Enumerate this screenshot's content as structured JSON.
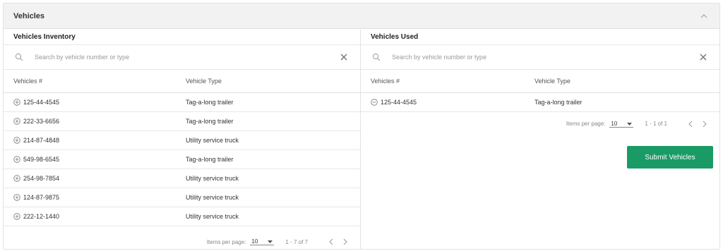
{
  "card": {
    "title": "Vehicles"
  },
  "inventory": {
    "title": "Vehicles Inventory",
    "search_placeholder": "Search by vehicle number or type",
    "columns": {
      "number": "Vehicles #",
      "type": "Vehicle Type"
    },
    "rows": [
      {
        "number": "125-44-4545",
        "type": "Tag-a-long trailer"
      },
      {
        "number": "222-33-6656",
        "type": "Tag-a-long trailer"
      },
      {
        "number": "214-87-4848",
        "type": "Utility service truck"
      },
      {
        "number": "549-98-6545",
        "type": "Tag-a-long trailer"
      },
      {
        "number": "254-98-7854",
        "type": "Utility service truck"
      },
      {
        "number": "124-87-9875",
        "type": "Utility service truck"
      },
      {
        "number": "222-12-1440",
        "type": "Utility service truck"
      }
    ],
    "pager": {
      "items_label": "Items per page:",
      "per_page": "10",
      "range": "1 - 7 of 7"
    }
  },
  "used": {
    "title": "Vehicles Used",
    "search_placeholder": "Search by vehicle number or type",
    "columns": {
      "number": "Vehicles #",
      "type": "Vehicle Type"
    },
    "rows": [
      {
        "number": "125-44-4545",
        "type": "Tag-a-long trailer"
      }
    ],
    "pager": {
      "items_label": "Items per page:",
      "per_page": "10",
      "range": "1 - 1 of 1"
    },
    "submit_label": "Submit Vehicles"
  },
  "icons": {
    "collapse": "chevron-up-icon",
    "search": "search-icon",
    "clear": "close-icon",
    "add": "plus-circle-icon",
    "remove": "minus-circle-icon",
    "dropdown": "caret-down-icon",
    "prev": "chevron-left-icon",
    "next": "chevron-right-icon"
  },
  "colors": {
    "accent": "#1a9b66",
    "header_bg": "#f2f2f2",
    "border": "#e2e2e2"
  }
}
